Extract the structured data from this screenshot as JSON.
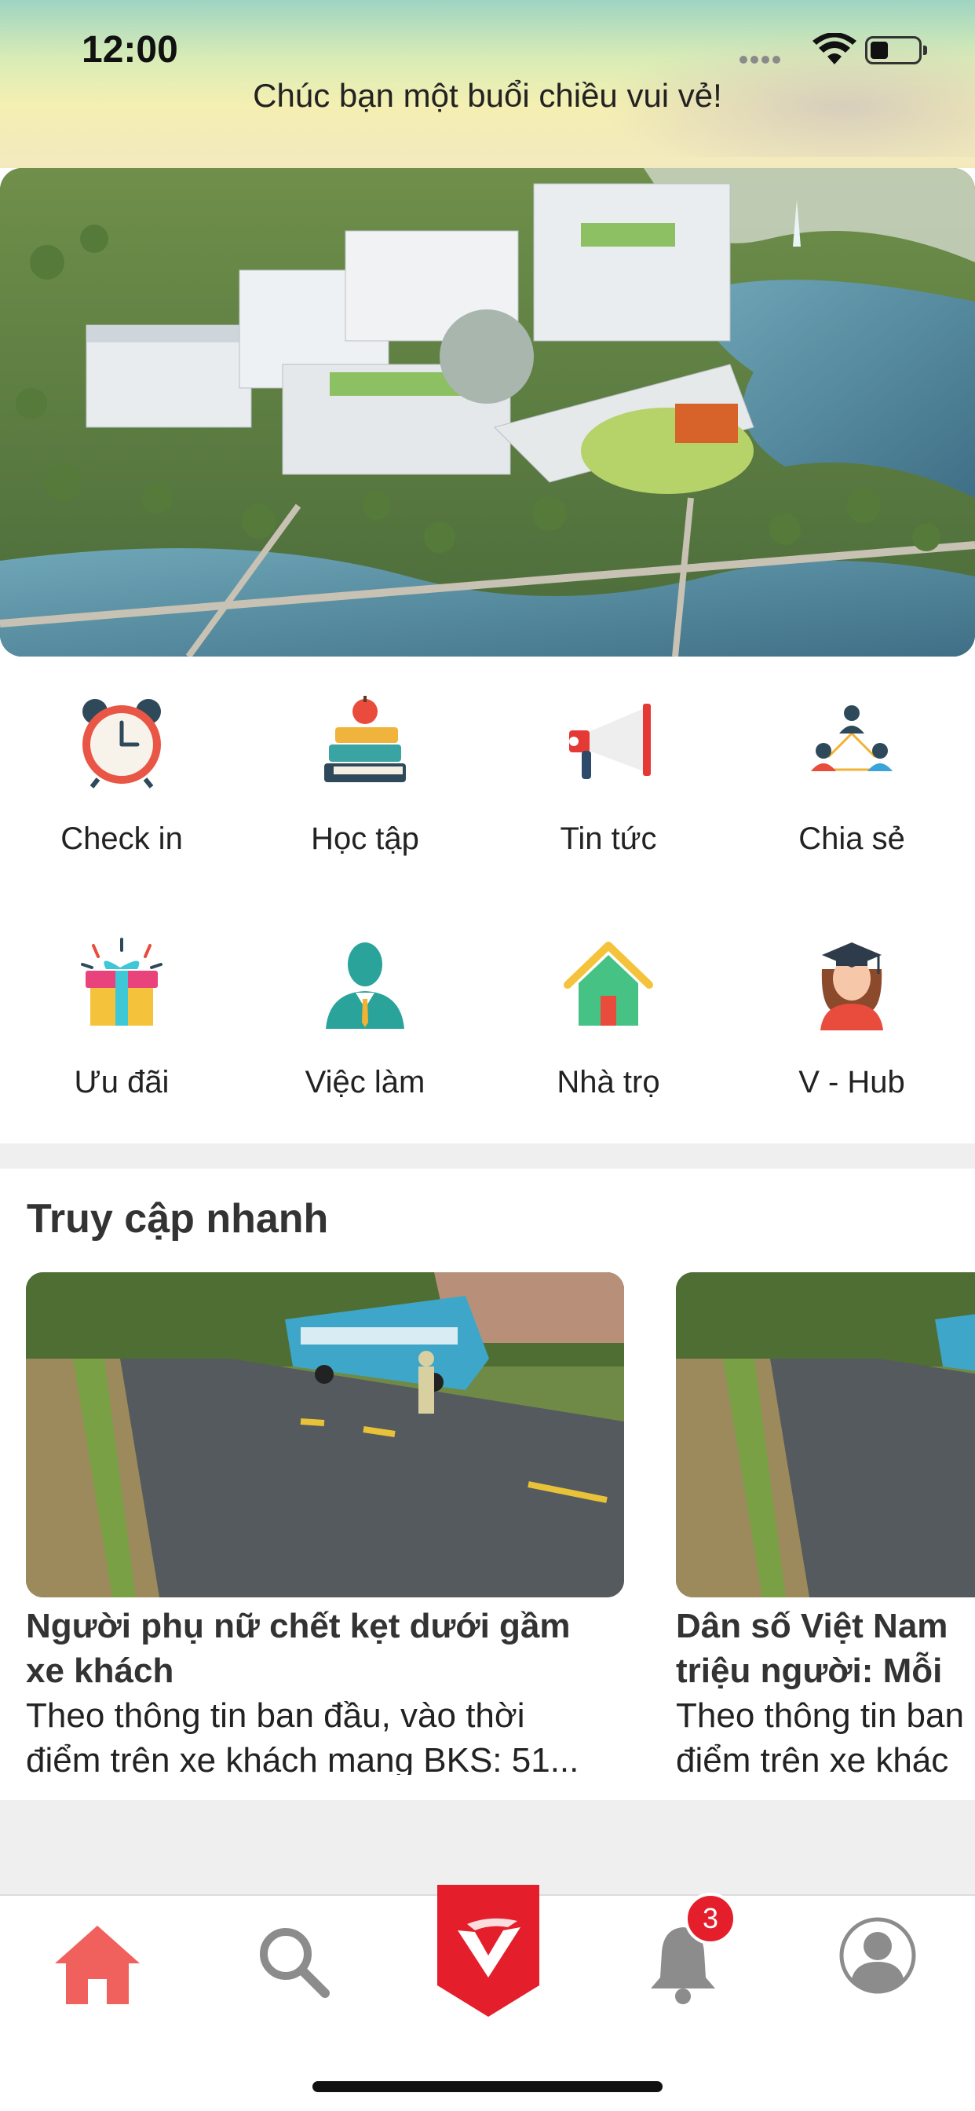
{
  "status_bar": {
    "time": "12:00"
  },
  "header": {
    "greeting": "Chúc bạn một buổi chiều vui vẻ!"
  },
  "menu": [
    {
      "label": "Check in",
      "icon": "alarm-clock-icon"
    },
    {
      "label": "Học tập",
      "icon": "books-apple-icon"
    },
    {
      "label": "Tin tức",
      "icon": "megaphone-icon"
    },
    {
      "label": "Chia sẻ",
      "icon": "people-network-icon"
    },
    {
      "label": "Ưu đãi",
      "icon": "gift-icon"
    },
    {
      "label": "Việc làm",
      "icon": "businessman-icon"
    },
    {
      "label": "Nhà trọ",
      "icon": "house-icon"
    },
    {
      "label": "V - Hub",
      "icon": "graduate-icon"
    }
  ],
  "quick_access": {
    "title": "Truy cập nhanh",
    "cards": [
      {
        "title_line1": "Người phụ nữ chết kẹt dưới gầm",
        "title_line2": "xe khách",
        "desc_line1": "Theo thông tin ban đầu, vào thời",
        "desc_line2": "điểm trên xe khách mang BKS: 51..."
      },
      {
        "title_line1": "Dân số Việt Nam",
        "title_line2": "triệu người: Mỗi",
        "desc_line1": "Theo thông tin ban",
        "desc_line2": "điểm trên xe khác"
      }
    ]
  },
  "tabbar": {
    "notification_count": "3",
    "active_color": "#f0605d",
    "inactive_color": "#8c8c8c",
    "brand_color": "#e41e2b"
  }
}
